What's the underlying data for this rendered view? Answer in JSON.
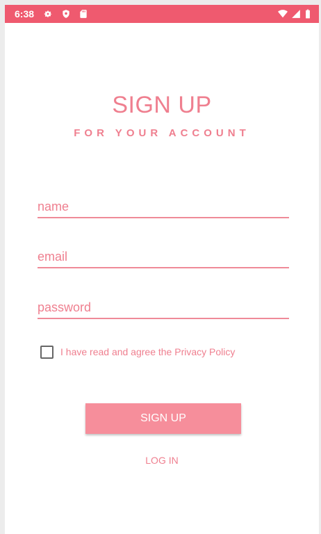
{
  "status_bar": {
    "time": "6:38",
    "color": "#ef5a6f",
    "left_icons": [
      "gear-icon",
      "shield-icon",
      "sd-card-icon"
    ],
    "right_icons": [
      "wifi-icon",
      "signal-icon",
      "battery-icon"
    ]
  },
  "header": {
    "title": "SIGN UP",
    "subtitle": "FOR YOUR ACCOUNT"
  },
  "form": {
    "name": {
      "placeholder": "name",
      "value": ""
    },
    "email": {
      "placeholder": "email",
      "value": ""
    },
    "password": {
      "placeholder": "password",
      "value": ""
    },
    "privacy_checkbox": {
      "label": "I have read and agree the Privacy Policy",
      "checked": false
    }
  },
  "actions": {
    "signup_label": "SIGN UP",
    "login_label": "LOG IN"
  },
  "colors": {
    "accent": "#ef7f8f",
    "button": "#f68e9b",
    "status_bar": "#ef5a6f"
  }
}
